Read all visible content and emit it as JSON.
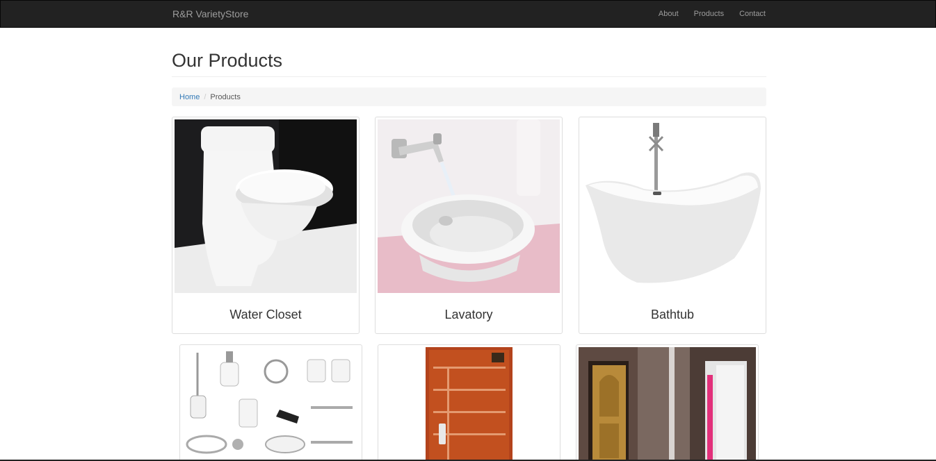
{
  "nav": {
    "brand": "R&R VarietyStore",
    "links": [
      "About",
      "Products",
      "Contact"
    ]
  },
  "header": {
    "title": "Our Products"
  },
  "breadcrumb": {
    "home": "Home",
    "separator": "/",
    "current": "Products"
  },
  "products": [
    {
      "name": "Water Closet",
      "image": "toilet-image"
    },
    {
      "name": "Lavatory",
      "image": "sink-image"
    },
    {
      "name": "Bathtub",
      "image": "bathtub-image"
    },
    {
      "name": "",
      "image": "bathroom-accessories-image"
    },
    {
      "name": "",
      "image": "wooden-door-image"
    },
    {
      "name": "",
      "image": "interior-doors-image"
    }
  ],
  "colors": {
    "navbar_bg": "#222222",
    "link_blue": "#337ab7",
    "breadcrumb_bg": "#f5f5f5"
  }
}
